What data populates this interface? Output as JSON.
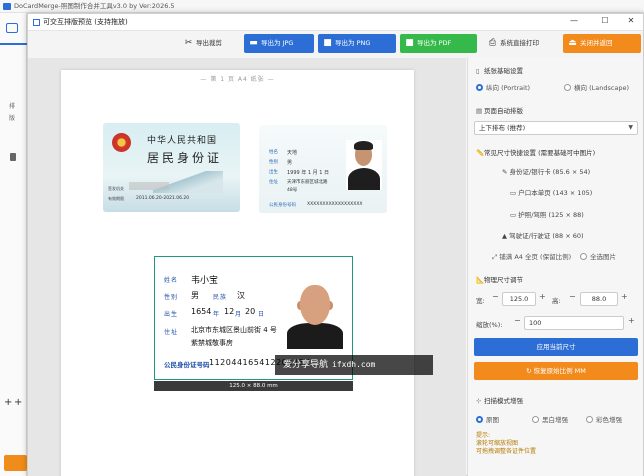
{
  "background": {
    "title": "DoCardMerge-照图制作合并工具v3.0 by Ver:2026.5",
    "sidebar_items": [
      "排",
      "版"
    ]
  },
  "dialog": {
    "title": "可交互排版预览 (支持拖放)",
    "minimize": "—",
    "maximize": "☐",
    "close": "✕"
  },
  "toolbar": {
    "cut": "导出裁剪",
    "export_jpg": "导出为 JPG",
    "export_png": "导出为 PNG",
    "export_pdf": "导出为 PDF",
    "print": "系统直接打印",
    "close": "关闭并返回"
  },
  "canvas": {
    "page_label": "— 第 1 页 A4 纸张 —",
    "size_label": "125.0 × 88.0 mm",
    "watermark_text": "爱分享导航",
    "watermark_domain": "ifxdh.com"
  },
  "id_front": {
    "country": "中华人民共和国",
    "card_name": "居民身份证",
    "agency_label": "签发机关",
    "valid_label": "有效期限",
    "valid_value": "2011.06.20-2021.06.20"
  },
  "id_back": {
    "name_label": "姓名",
    "name_value": "天地",
    "sex_label": "性别",
    "sex_value": "男",
    "birth_label": "出生",
    "birth_value": "1999 年 1 月 1 日",
    "addr_label": "住址",
    "addr_value": "天津市东丽区城北路",
    "addr_value2": "48号",
    "id_label": "公民身份号码",
    "id_value": "XXXXXXXXXXXXXXXXXX"
  },
  "selected_card": {
    "name_label": "姓名",
    "name_value": "韦小宝",
    "sex_label": "性别",
    "sex_value": "男",
    "ethnic_label": "民族",
    "ethnic_value": "汉",
    "birth_label": "出生",
    "birth_year": "1654",
    "birth_month": "12",
    "birth_day": "20",
    "year_unit": "年",
    "month_unit": "月",
    "day_unit": "日",
    "addr_label": "住址",
    "addr_line1": "北京市东城区景山前街 4 号",
    "addr_line2": "紫禁城敬事房",
    "id_label": "公民身份证号码",
    "id_value": "112044165412202​43X"
  },
  "panel": {
    "orientation_title": "纸张基础设置",
    "portrait": "纵向 (Portrait)",
    "landscape": "横向 (Landscape)",
    "layout_title": "页面自动排版",
    "layout_select": "上下排布 (推荐)",
    "presets_title": "常见尺寸快捷设置 (需要基础可中图片)",
    "preset1": "身份证/银行卡 (85.6 × 54)",
    "preset2": "户口本单页 (143 × 105)",
    "preset3": "护照/驾照 (125 × 88)",
    "preset4": "驾驶证/行驶证 (88 × 60)",
    "fill_a4": "铺满 A4 全页 (保留比例)",
    "fill_full": "全选图片",
    "size_title": "物理尺寸调节",
    "width_label": "宽:",
    "width_value": "125.0",
    "height_label": "高:",
    "height_value": "88.0",
    "scale_label": "缩放(%):",
    "scale_value": "100",
    "apply_btn": "应用当前尺寸",
    "reset_btn": "恢复原始比例 MM",
    "enhance_title": "扫描模式增强",
    "mode1": "原图",
    "mode2": "黑白增强",
    "mode3": "彩色增强",
    "tip1": "提示:",
    "tip2": "滚轮可缩放视图",
    "tip3": "可拖拽调整各证件位置"
  },
  "colors": {
    "blue": "#2c6ed5",
    "green": "#35b94a",
    "orange": "#f28b1c",
    "teal": "#1e9b7f"
  }
}
